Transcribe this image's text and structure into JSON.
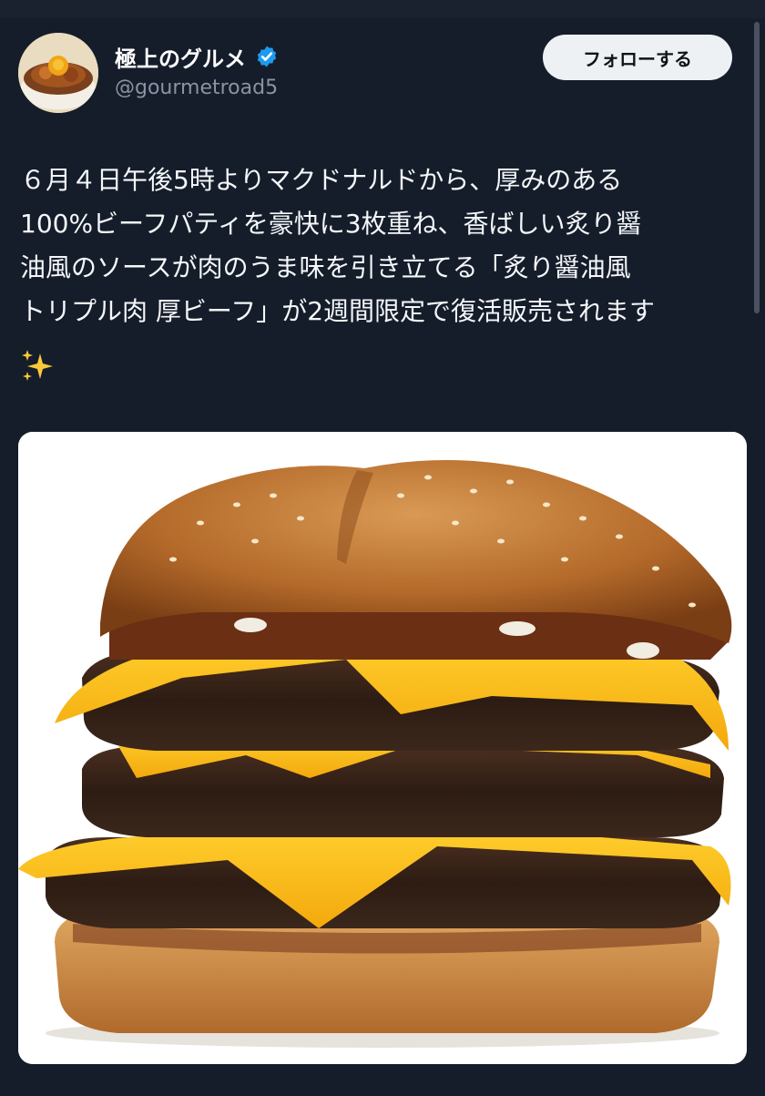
{
  "author": {
    "display_name": "極上のグルメ",
    "handle": "@gourmetroad5",
    "verified": true,
    "avatar_icon": "food-bowl-avatar"
  },
  "follow_button": {
    "label": "フォローする"
  },
  "tweet": {
    "text": "６月４日午後5時よりマクドナルドから、厚みのある\n100%ビーフパティを豪快に3枚重ね、香ばしい炙り醤\n油風のソースが肉のうま味を引き立てる「炙り醤油風\nトリプル肉 厚ビーフ」が2週間限定で復活販売されます",
    "emoji_icon": "sparkles-icon"
  },
  "media": {
    "icon": "triple-beef-burger-photo"
  },
  "colors": {
    "background": "#151d2a",
    "verified": "#1d9bf0",
    "follow_bg": "#eef1f4",
    "handle": "#8a93a3"
  }
}
